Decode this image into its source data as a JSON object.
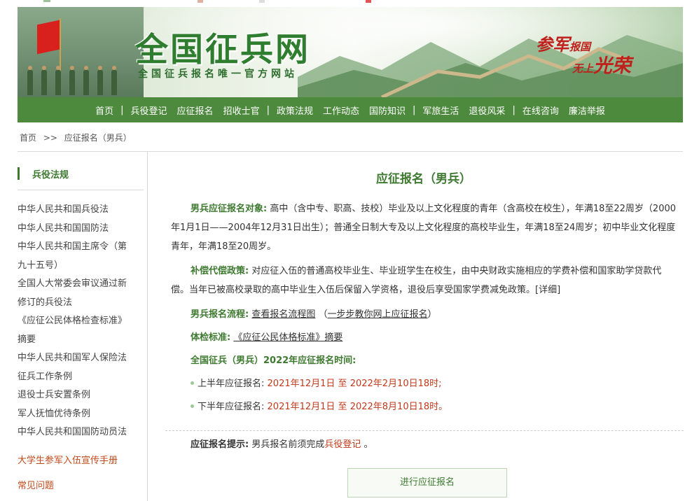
{
  "banner": {
    "site_title": "全国征兵网",
    "site_subtitle": "全国征兵报名唯一官方网站",
    "slogan_a": "参军",
    "slogan_b": "报国",
    "slogan_c": "无上",
    "slogan_d": "光荣"
  },
  "nav": {
    "groups": [
      [
        "首页",
        "兵役登记",
        "应征报名",
        "招收士官"
      ],
      [
        "政策法规",
        "工作动态",
        "国防知识"
      ],
      [
        "军旅生活",
        "退役风采"
      ],
      [
        "在线咨询",
        "廉洁举报"
      ]
    ]
  },
  "breadcrumb": {
    "home": "首页",
    "sep": ">>",
    "current": "应征报名（男兵）"
  },
  "sidebar": {
    "title": "兵役法规",
    "items": [
      "中华人民共和国兵役法",
      "中华人民共和国国防法",
      "中华人民共和国主席令（第",
      "九十五号）",
      "全国人大常委会审议通过新",
      "修订的兵役法",
      "《应征公民体格检查标准》",
      "摘要",
      "中华人民共和国军人保险法",
      "征兵工作条例",
      "退役士兵安置条例",
      "军人抚恤优待条例",
      "中华人民共和国国防动员法"
    ],
    "extra1": "大学生参军入伍宣传手册",
    "extra2": "常见问题"
  },
  "main": {
    "title": "应征报名（男兵）",
    "target_label": "男兵应征报名对象:",
    "target_text": "高中（含中专、职高、技校）毕业及以上文化程度的青年（含高校在校生），年满18至22周岁（2000年1月1日——2004年12月31日出生）；普通全日制大专及以上文化程度的高校毕业生，年满18至24周岁；初中毕业文化程度青年，年满18至20周岁。",
    "policy_label": "补偿代偿政策:",
    "policy_text": "对应征入伍的普通高校毕业生、毕业班学生在校生，由中央财政实施相应的学费补偿和国家助学贷款代偿。当年已被高校录取的高中毕业生入伍后保留入学资格，退役后享受国家学费减免政策。",
    "policy_link": "[详细]",
    "flow_label": "男兵报名流程:",
    "flow_link1": "查看报名流程图",
    "flow_paren_open": "（",
    "flow_link2": "一步步教你网上应征报名",
    "flow_paren_close": "）",
    "exam_label": "体检标准:",
    "exam_link": "《应征公民体格标准》摘要",
    "time_label": "全国征兵（男兵）2022年应征报名时间:",
    "first_half_label": "上半年应征报名:",
    "first_half_value": "2021年12月1日 至 2022年2月10日18时;",
    "second_half_label": "下半年应征报名:",
    "second_half_value": "2021年12月1日 至 2022年8月10日18时。",
    "tip_label": "应征报名提示:",
    "tip_text": "男兵报名前须完成",
    "tip_link": "兵役登记",
    "tip_end": "。",
    "apply_button": "进行应征报名"
  }
}
